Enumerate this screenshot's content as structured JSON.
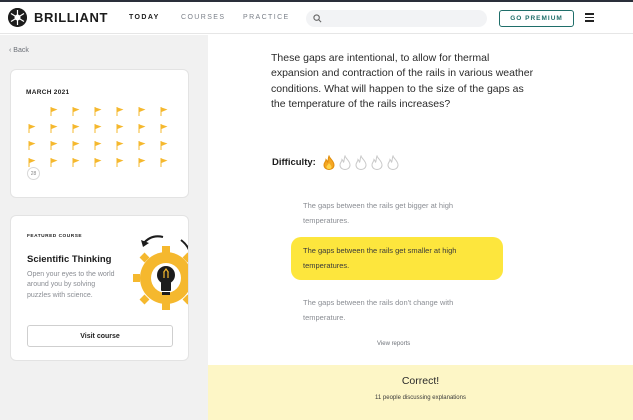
{
  "header": {
    "brand": "BRILLIANT",
    "nav": [
      "TODAY",
      "COURSES",
      "PRACTICE"
    ],
    "search_placeholder": "",
    "premium_label": "GO PREMIUM"
  },
  "sidebar": {
    "back_label": "Back",
    "calendar": {
      "month": "MARCH 2021",
      "day_badge": "28",
      "flag_color": "#f5b82e"
    },
    "course": {
      "featured_label": "FEATURED COURSE",
      "title": "Scientific Thinking",
      "description": "Open your eyes to the world around you by solving puzzles with science.",
      "visit_label": "Visit course"
    }
  },
  "main": {
    "question": "These gaps are intentional, to allow for thermal expansion and contraction of the rails in various weather conditions. What will happen to the size of the gaps as the temperature of the rails increases?",
    "difficulty_label": "Difficulty:",
    "difficulty_level": 1,
    "difficulty_max": 5,
    "options": [
      {
        "label": "The gaps between the rails get bigger at high temperatures.",
        "selected": false
      },
      {
        "label": "The gaps between the rails get smaller at high temperatures.",
        "selected": true
      },
      {
        "label": "The gaps between the rails don't change with temperature.",
        "selected": false
      }
    ],
    "view_reports": "View reports"
  },
  "result": {
    "title": "Correct!",
    "subtitle": "11 people discussing explanations"
  },
  "colors": {
    "accent_yellow": "#fde63d",
    "premium_teal": "#1f6e6a",
    "result_bg": "#fdf6c6"
  }
}
